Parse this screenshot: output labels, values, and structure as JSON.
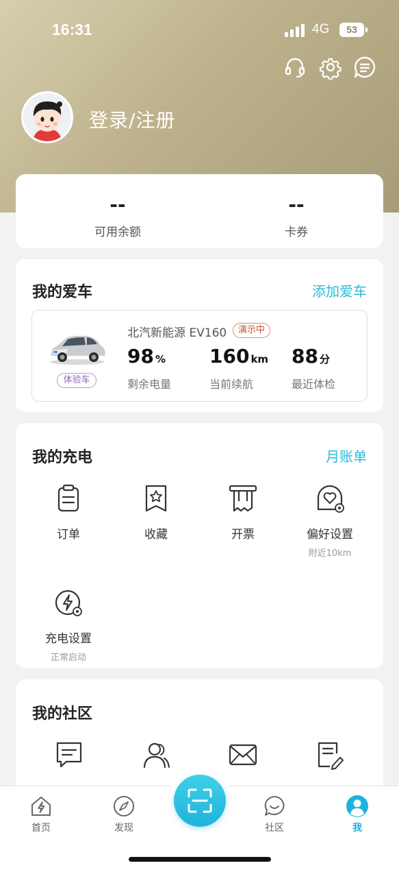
{
  "status_bar": {
    "time": "16:31",
    "network": "4G",
    "battery": "53"
  },
  "header": {
    "icons": [
      "headset-icon",
      "gear-icon",
      "message-icon"
    ],
    "login_label": "登录/注册"
  },
  "balance": {
    "items": [
      {
        "value": "--",
        "label": "可用余额"
      },
      {
        "value": "--",
        "label": "卡券"
      }
    ]
  },
  "my_car": {
    "title": "我的爱车",
    "action": "添加爱车",
    "car": {
      "name": "北汽新能源 EV160",
      "status_badge": "演示中",
      "trial_badge": "体验车",
      "stats": [
        {
          "value": "98",
          "unit": "%",
          "label": "剩余电量"
        },
        {
          "value": "160",
          "unit": "km",
          "label": "当前续航"
        },
        {
          "value": "88",
          "unit": "分",
          "label": "最近体检"
        }
      ]
    }
  },
  "my_charging": {
    "title": "我的充电",
    "action": "月账单",
    "items": [
      {
        "label": "订单",
        "sub": "",
        "icon": "clipboard-icon"
      },
      {
        "label": "收藏",
        "sub": "",
        "icon": "bookmark-star-icon"
      },
      {
        "label": "开票",
        "sub": "",
        "icon": "invoice-icon"
      },
      {
        "label": "偏好设置",
        "sub": "附近10km",
        "icon": "preference-heart-icon"
      },
      {
        "label": "充电设置",
        "sub": "正常启动",
        "icon": "charge-settings-icon"
      }
    ]
  },
  "my_community": {
    "title": "我的社区",
    "items": [
      {
        "icon": "comment-icon"
      },
      {
        "icon": "users-icon"
      },
      {
        "icon": "mail-icon"
      },
      {
        "icon": "note-edit-icon"
      }
    ]
  },
  "tabbar": {
    "tabs": [
      {
        "label": "首页",
        "icon": "home-bolt-icon",
        "active": false
      },
      {
        "label": "发现",
        "icon": "compass-icon",
        "active": false
      },
      {
        "label": "社区",
        "icon": "chat-smile-icon",
        "active": false
      },
      {
        "label": "我",
        "icon": "user-icon",
        "active": true
      }
    ],
    "scan_icon": "scan-icon"
  },
  "colors": {
    "accent": "#29b9d8",
    "header": "#bdb28c",
    "active_tab": "#1fb3dc"
  }
}
